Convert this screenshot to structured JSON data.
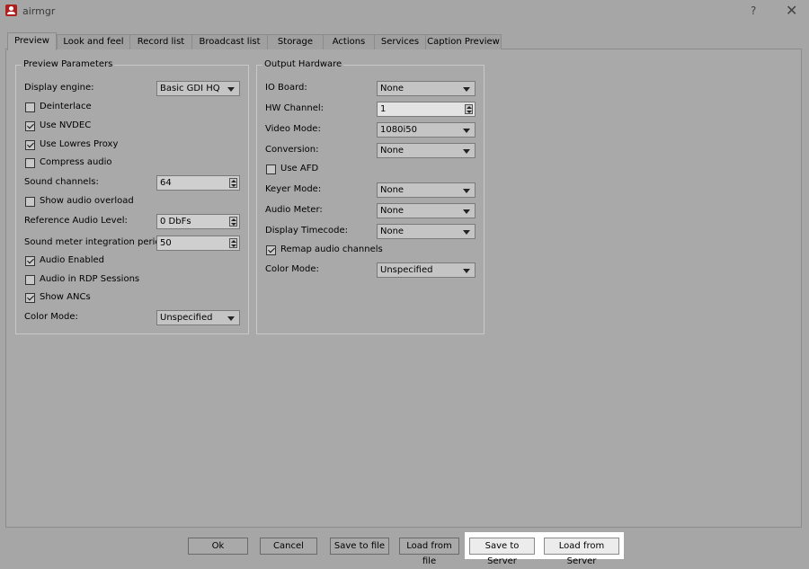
{
  "window": {
    "title": "airmgr",
    "help_label": "?",
    "close_label": "✕",
    "icon": "app-logo-icon"
  },
  "tabs": [
    {
      "label": "Preview",
      "active": true
    },
    {
      "label": "Look and feel"
    },
    {
      "label": "Record list"
    },
    {
      "label": "Broadcast list"
    },
    {
      "label": "Storage"
    },
    {
      "label": "Actions"
    },
    {
      "label": "Services"
    },
    {
      "label": "Caption Preview"
    }
  ],
  "preview_parameters": {
    "title": "Preview Parameters",
    "display_engine_label": "Display engine:",
    "display_engine_value": "Basic GDI HQ",
    "deinterlace_label": "Deinterlace",
    "deinterlace_checked": false,
    "use_nvdec_label": "Use NVDEC",
    "use_nvdec_checked": true,
    "use_lowres_label": "Use Lowres Proxy",
    "use_lowres_checked": true,
    "compress_audio_label": "Compress audio",
    "compress_audio_checked": false,
    "sound_channels_label": "Sound channels:",
    "sound_channels_value": "64",
    "show_audio_overload_label": "Show audio overload",
    "show_audio_overload_checked": false,
    "reference_audio_label": "Reference Audio Level:",
    "reference_audio_value": "0 DbFs",
    "sound_meter_label": "Sound meter integration period:",
    "sound_meter_value": "50",
    "audio_enabled_label": "Audio Enabled",
    "audio_enabled_checked": true,
    "audio_rdp_label": "Audio in RDP Sessions",
    "audio_rdp_checked": false,
    "show_ancs_label": "Show ANCs",
    "show_ancs_checked": true,
    "color_mode_label": "Color Mode:",
    "color_mode_value": "Unspecified"
  },
  "output_hardware": {
    "title": "Output Hardware",
    "io_board_label": "IO Board:",
    "io_board_value": "None",
    "hw_channel_label": "HW Channel:",
    "hw_channel_value": "1",
    "video_mode_label": "Video Mode:",
    "video_mode_value": "1080i50",
    "conversion_label": "Conversion:",
    "conversion_value": "None",
    "use_afd_label": "Use AFD",
    "use_afd_checked": false,
    "keyer_mode_label": "Keyer Mode:",
    "keyer_mode_value": "None",
    "audio_meter_label": "Audio Meter:",
    "audio_meter_value": "None",
    "display_timecode_label": "Display Timecode:",
    "display_timecode_value": "None",
    "remap_audio_label": "Remap audio channels",
    "remap_audio_checked": true,
    "color_mode_label": "Color Mode:",
    "color_mode_value": "Unspecified"
  },
  "buttons": {
    "ok": "Ok",
    "cancel": "Cancel",
    "save_to_file": "Save to file",
    "load_from_file": "Load from file",
    "save_to_server": "Save to Server",
    "load_from_server": "Load from Server"
  },
  "colors": {
    "background": "#a6a6a6",
    "highlight": "#ffffff",
    "app_icon": "#b01e1e"
  }
}
